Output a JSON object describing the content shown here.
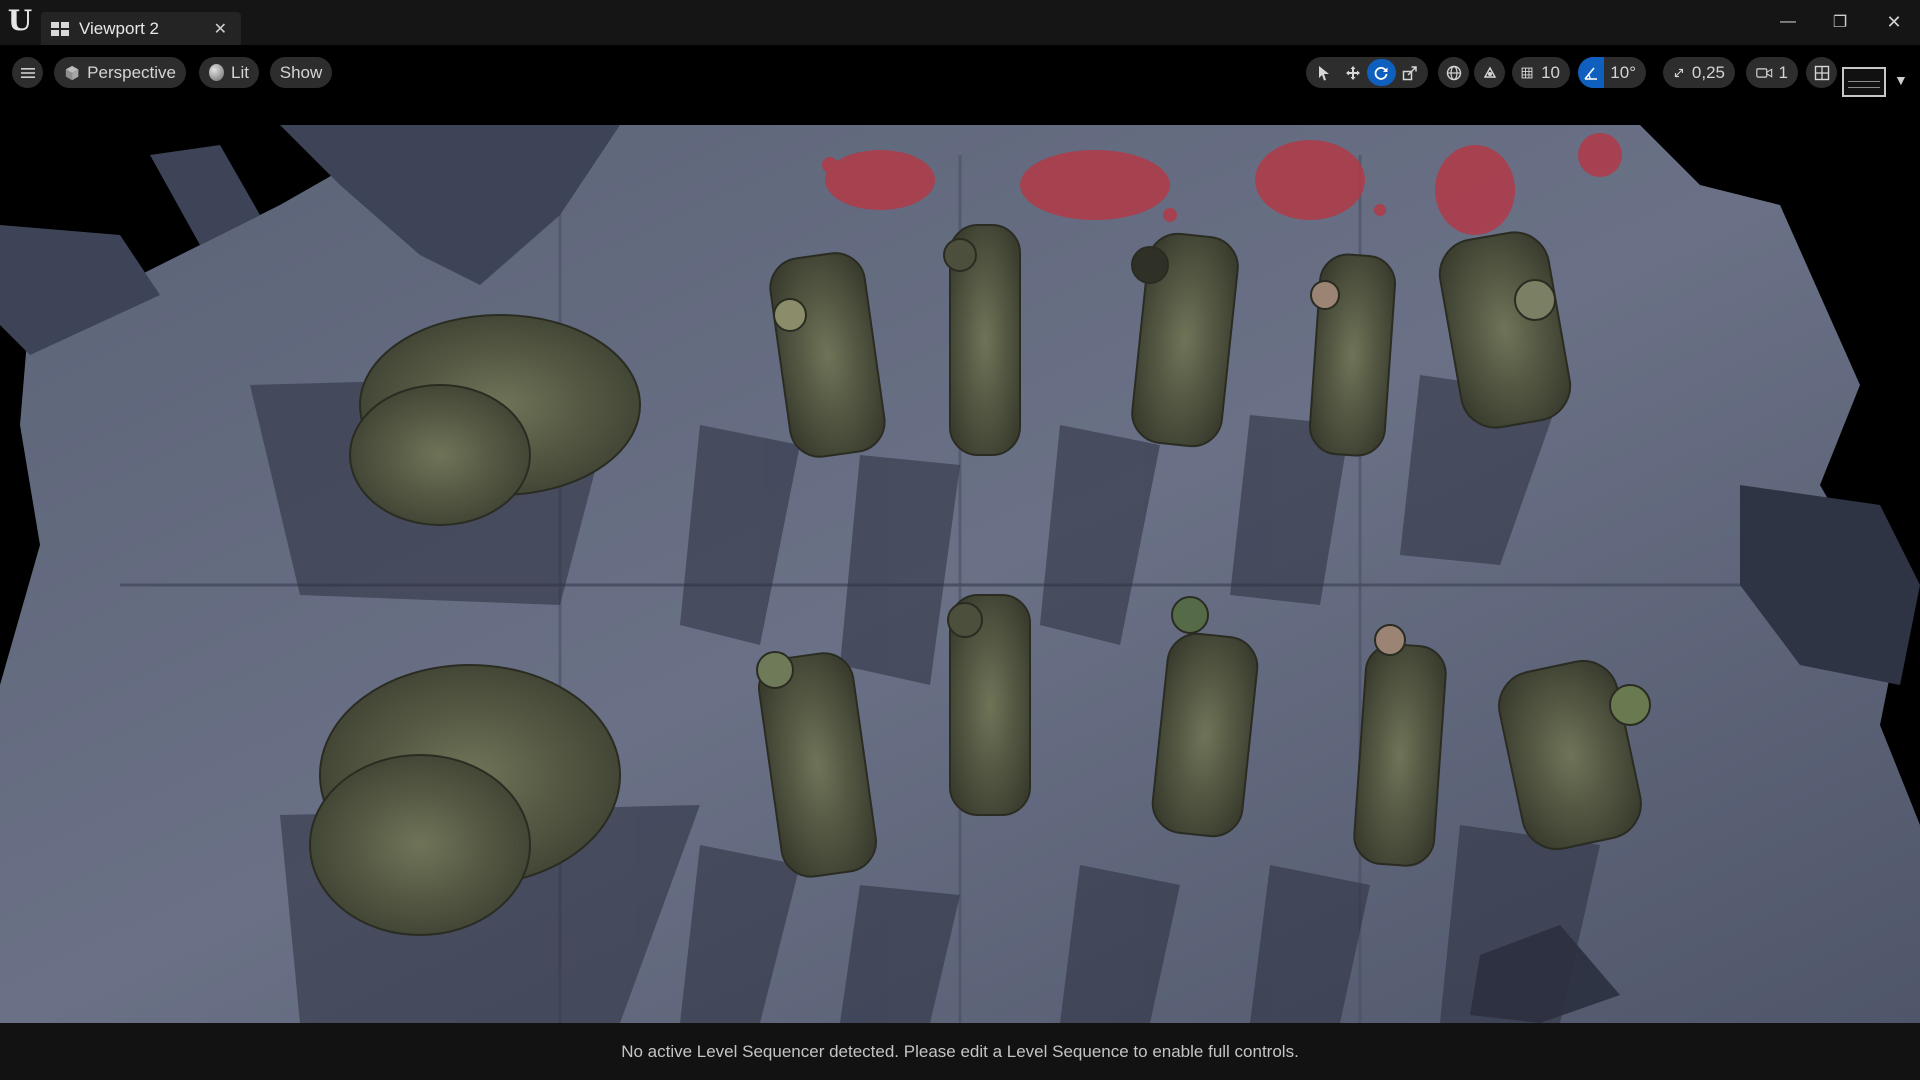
{
  "window": {
    "tab_title": "Viewport 2",
    "tab_close_glyph": "✕",
    "minimize_glyph": "—",
    "restore_glyph": "❐",
    "close_glyph": "✕"
  },
  "toolbar": {
    "menu_icon": "hamburger-icon",
    "perspective_label": "Perspective",
    "lit_label": "Lit",
    "show_label": "Show",
    "grid_snap_value": "10",
    "rotation_snap_value": "10°",
    "scale_snap_value": "0,25",
    "camera_speed_value": "1",
    "active_tool": "rotate",
    "accent_color": "#0f5fbf"
  },
  "viewport": {
    "scene": "top-down view of soldier characters lying on a concrete floor with debris and blood decals"
  },
  "footer": {
    "message": "No active Level Sequencer detected. Please edit a Level Sequence to enable full controls."
  }
}
